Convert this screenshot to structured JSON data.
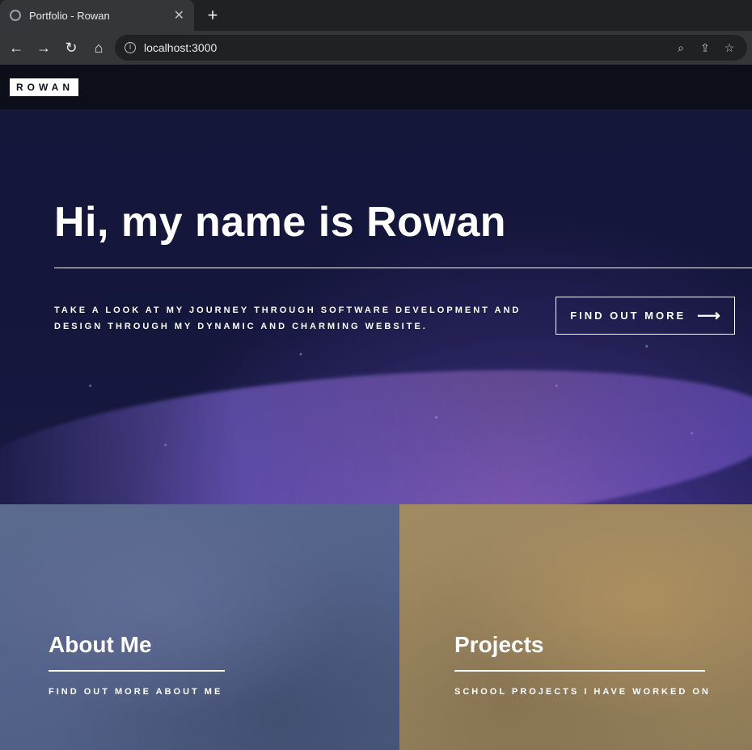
{
  "browser": {
    "tab_title": "Portfolio - Rowan",
    "new_tab_label": "+",
    "url": "localhost:3000"
  },
  "icons": {
    "tab_favicon": "globe-icon",
    "tab_close": "close-icon",
    "back": "arrow-left-icon",
    "forward": "arrow-right-icon",
    "reload": "reload-icon",
    "home": "home-icon",
    "site_info": "info-icon",
    "zoom": "zoom-icon",
    "share": "share-icon",
    "bookmark": "star-icon",
    "cta_arrow": "arrow-right-icon"
  },
  "site": {
    "brand": "ROWAN",
    "hero": {
      "title": "Hi, my name is Rowan",
      "subtitle": "Take a look at my journey through software development and design through my dynamic and charming website.",
      "cta_label": "FIND OUT MORE"
    },
    "tiles": [
      {
        "title": "About Me",
        "subtitle": "FIND OUT MORE ABOUT ME"
      },
      {
        "title": "Projects",
        "subtitle": "SCHOOL PROJECTS I HAVE WORKED ON"
      }
    ]
  },
  "colors": {
    "browser_bg": "#202124",
    "toolbar_bg": "#35363a",
    "site_topbar": "#0c0f1a",
    "about_tile": "#53638a",
    "projects_tile": "#9c8660"
  }
}
